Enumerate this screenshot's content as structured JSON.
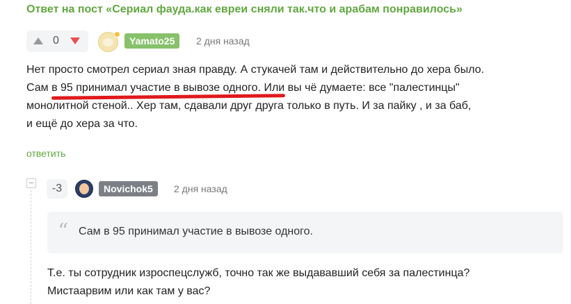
{
  "post_link": "Ответ на пост «Сериал фауда.как евреи сняли так.что и арабам понравилось»",
  "comment": {
    "rating": "0",
    "username": "Yamato25",
    "time": "2 дня назад",
    "lines": [
      "Нет просто смотрел сериал зная правду. А стукачей там и действительно до хера было.",
      "Сам в 95 принимал участие в вывозе одного. Или вы чё думаете: все \"палестинцы\"",
      "монолитной стеной.. Хер там, сдавали друг друга только в путь. И за пайку , и за баб,",
      "и ещё до хера за что."
    ],
    "reply_label": "ответить"
  },
  "reply": {
    "rating": "-3",
    "username": "Novichok5",
    "time": "2 дня назад",
    "quote": "Сам в 95 принимал участие в вывозе одного.",
    "lines": [
      "Т.е. ты сотрудник изроспецслужб, точно так же выдававший себя за палестинца?",
      "Мистаарвим или как там у вас?"
    ]
  },
  "icons": {
    "upvote": "arrow-up-icon",
    "downvote": "arrow-down-icon",
    "collapse": "minus-icon",
    "quote": "quote-icon"
  },
  "colors": {
    "accent_green": "#61a73f",
    "tag_green": "#87c16a",
    "tag_gray": "#7c8086",
    "downvote_red": "#e9504c",
    "underline_red": "#e0191d"
  }
}
